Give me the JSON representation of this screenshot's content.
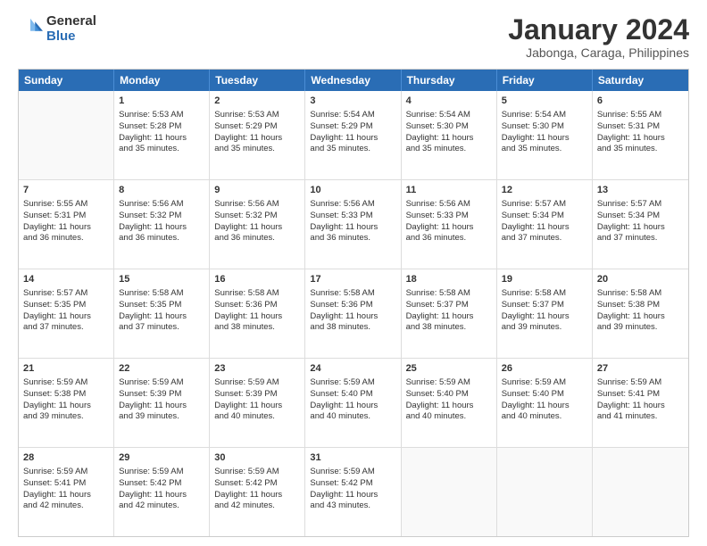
{
  "logo": {
    "general": "General",
    "blue": "Blue"
  },
  "title": "January 2024",
  "subtitle": "Jabonga, Caraga, Philippines",
  "days": [
    "Sunday",
    "Monday",
    "Tuesday",
    "Wednesday",
    "Thursday",
    "Friday",
    "Saturday"
  ],
  "weeks": [
    [
      {
        "day": "",
        "content": ""
      },
      {
        "day": "1",
        "content": "Sunrise: 5:53 AM\nSunset: 5:28 PM\nDaylight: 11 hours\nand 35 minutes."
      },
      {
        "day": "2",
        "content": "Sunrise: 5:53 AM\nSunset: 5:29 PM\nDaylight: 11 hours\nand 35 minutes."
      },
      {
        "day": "3",
        "content": "Sunrise: 5:54 AM\nSunset: 5:29 PM\nDaylight: 11 hours\nand 35 minutes."
      },
      {
        "day": "4",
        "content": "Sunrise: 5:54 AM\nSunset: 5:30 PM\nDaylight: 11 hours\nand 35 minutes."
      },
      {
        "day": "5",
        "content": "Sunrise: 5:54 AM\nSunset: 5:30 PM\nDaylight: 11 hours\nand 35 minutes."
      },
      {
        "day": "6",
        "content": "Sunrise: 5:55 AM\nSunset: 5:31 PM\nDaylight: 11 hours\nand 35 minutes."
      }
    ],
    [
      {
        "day": "7",
        "content": "Sunrise: 5:55 AM\nSunset: 5:31 PM\nDaylight: 11 hours\nand 36 minutes."
      },
      {
        "day": "8",
        "content": "Sunrise: 5:56 AM\nSunset: 5:32 PM\nDaylight: 11 hours\nand 36 minutes."
      },
      {
        "day": "9",
        "content": "Sunrise: 5:56 AM\nSunset: 5:32 PM\nDaylight: 11 hours\nand 36 minutes."
      },
      {
        "day": "10",
        "content": "Sunrise: 5:56 AM\nSunset: 5:33 PM\nDaylight: 11 hours\nand 36 minutes."
      },
      {
        "day": "11",
        "content": "Sunrise: 5:56 AM\nSunset: 5:33 PM\nDaylight: 11 hours\nand 36 minutes."
      },
      {
        "day": "12",
        "content": "Sunrise: 5:57 AM\nSunset: 5:34 PM\nDaylight: 11 hours\nand 37 minutes."
      },
      {
        "day": "13",
        "content": "Sunrise: 5:57 AM\nSunset: 5:34 PM\nDaylight: 11 hours\nand 37 minutes."
      }
    ],
    [
      {
        "day": "14",
        "content": "Sunrise: 5:57 AM\nSunset: 5:35 PM\nDaylight: 11 hours\nand 37 minutes."
      },
      {
        "day": "15",
        "content": "Sunrise: 5:58 AM\nSunset: 5:35 PM\nDaylight: 11 hours\nand 37 minutes."
      },
      {
        "day": "16",
        "content": "Sunrise: 5:58 AM\nSunset: 5:36 PM\nDaylight: 11 hours\nand 38 minutes."
      },
      {
        "day": "17",
        "content": "Sunrise: 5:58 AM\nSunset: 5:36 PM\nDaylight: 11 hours\nand 38 minutes."
      },
      {
        "day": "18",
        "content": "Sunrise: 5:58 AM\nSunset: 5:37 PM\nDaylight: 11 hours\nand 38 minutes."
      },
      {
        "day": "19",
        "content": "Sunrise: 5:58 AM\nSunset: 5:37 PM\nDaylight: 11 hours\nand 39 minutes."
      },
      {
        "day": "20",
        "content": "Sunrise: 5:58 AM\nSunset: 5:38 PM\nDaylight: 11 hours\nand 39 minutes."
      }
    ],
    [
      {
        "day": "21",
        "content": "Sunrise: 5:59 AM\nSunset: 5:38 PM\nDaylight: 11 hours\nand 39 minutes."
      },
      {
        "day": "22",
        "content": "Sunrise: 5:59 AM\nSunset: 5:39 PM\nDaylight: 11 hours\nand 39 minutes."
      },
      {
        "day": "23",
        "content": "Sunrise: 5:59 AM\nSunset: 5:39 PM\nDaylight: 11 hours\nand 40 minutes."
      },
      {
        "day": "24",
        "content": "Sunrise: 5:59 AM\nSunset: 5:40 PM\nDaylight: 11 hours\nand 40 minutes."
      },
      {
        "day": "25",
        "content": "Sunrise: 5:59 AM\nSunset: 5:40 PM\nDaylight: 11 hours\nand 40 minutes."
      },
      {
        "day": "26",
        "content": "Sunrise: 5:59 AM\nSunset: 5:40 PM\nDaylight: 11 hours\nand 40 minutes."
      },
      {
        "day": "27",
        "content": "Sunrise: 5:59 AM\nSunset: 5:41 PM\nDaylight: 11 hours\nand 41 minutes."
      }
    ],
    [
      {
        "day": "28",
        "content": "Sunrise: 5:59 AM\nSunset: 5:41 PM\nDaylight: 11 hours\nand 42 minutes."
      },
      {
        "day": "29",
        "content": "Sunrise: 5:59 AM\nSunset: 5:42 PM\nDaylight: 11 hours\nand 42 minutes."
      },
      {
        "day": "30",
        "content": "Sunrise: 5:59 AM\nSunset: 5:42 PM\nDaylight: 11 hours\nand 42 minutes."
      },
      {
        "day": "31",
        "content": "Sunrise: 5:59 AM\nSunset: 5:42 PM\nDaylight: 11 hours\nand 43 minutes."
      },
      {
        "day": "",
        "content": ""
      },
      {
        "day": "",
        "content": ""
      },
      {
        "day": "",
        "content": ""
      }
    ]
  ]
}
